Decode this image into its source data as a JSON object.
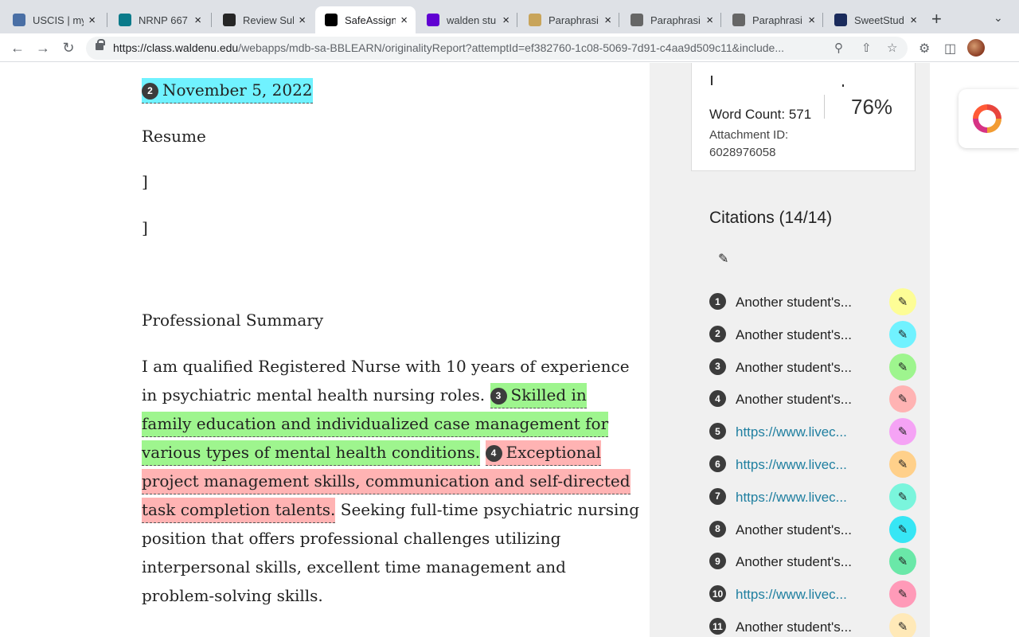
{
  "browser": {
    "tabs": [
      {
        "title": "USCIS | my",
        "favicon": "uscis-seal-icon",
        "color": "#4a6fa5"
      },
      {
        "title": "NRNP 667",
        "favicon": "wordpress-icon",
        "color": "#0a7a8a"
      },
      {
        "title": "Review Sub",
        "favicon": "blackboard-icon",
        "color": "#262626"
      },
      {
        "title": "SafeAssign",
        "favicon": "blackboard-icon",
        "color": "#000000",
        "active": true
      },
      {
        "title": "walden stu",
        "favicon": "yahoo-icon",
        "color": "#6001d2"
      },
      {
        "title": "Paraphrasi",
        "favicon": "quillbot-icon",
        "color": "#c8a45a"
      },
      {
        "title": "Paraphrasi",
        "favicon": "paraphrase-pen-icon",
        "color": "#666666"
      },
      {
        "title": "Paraphrasi",
        "favicon": "paraphrase-pen-icon",
        "color": "#666666"
      },
      {
        "title": "SweetStud",
        "favicon": "sweetstudy-icon",
        "color": "#1a2b5c"
      }
    ],
    "url": {
      "host": "https://class.waldenu.edu",
      "path": "/webapps/mdb-sa-BBLEARN/originalityReport?attemptId=ef382760-1c08-5069-7d91-c4aa9d509c11&include..."
    }
  },
  "document": {
    "date": "November 5, 2022",
    "date_citation": "2",
    "heading_resume": "Resume",
    "bracket1": "]",
    "bracket2": "]",
    "heading_summary": "Professional Summary",
    "lines": {
      "l1": "I am qualified Registered Nurse with 10 years of experience",
      "l2a": "in psychiatric mental health nursing roles.",
      "l2b_num": "3",
      "l2b": "Skilled in",
      "l3": "family education and individualized case management for",
      "l4a": "various types of mental health conditions.",
      "l4b_num": "4",
      "l4b": "Exceptional",
      "l5": "project management skills, communication and self-directed",
      "l6a": "task completion talents.",
      "l6b": " Seeking full-time psychiatric nursing",
      "l7": "position that offers professional challenges utilizing",
      "l8": "interpersonal skills, excellent time management and",
      "l9": "problem-solving skills."
    }
  },
  "report": {
    "word_count": "Word Count: 571",
    "match_percent": "76%",
    "attachment_label": "Attachment ID:",
    "attachment_id": "6028976058",
    "citations_title": "Citations (14/14)",
    "citations": [
      {
        "n": "1",
        "label": "Another student's...",
        "link": false,
        "color": "#fdfd96"
      },
      {
        "n": "2",
        "label": "Another student's...",
        "link": false,
        "color": "#70f2ff"
      },
      {
        "n": "3",
        "label": "Another student's...",
        "link": false,
        "color": "#9ef58e"
      },
      {
        "n": "4",
        "label": "Another student's...",
        "link": false,
        "color": "#ffb3b3"
      },
      {
        "n": "5",
        "label": "https://www.livec...",
        "link": true,
        "color": "#f5a3f5"
      },
      {
        "n": "6",
        "label": "https://www.livec...",
        "link": true,
        "color": "#ffd08a"
      },
      {
        "n": "7",
        "label": "https://www.livec...",
        "link": true,
        "color": "#7af5dc"
      },
      {
        "n": "8",
        "label": "Another student's...",
        "link": false,
        "color": "#37e6f5"
      },
      {
        "n": "9",
        "label": "Another student's...",
        "link": false,
        "color": "#6ae8a8"
      },
      {
        "n": "10",
        "label": "https://www.livec...",
        "link": true,
        "color": "#ff9ab8"
      },
      {
        "n": "11",
        "label": "Another student's...",
        "link": false,
        "color": "#ffe9b8"
      }
    ]
  },
  "colors": {
    "highlight_cyan": "#70f2ff",
    "highlight_green": "#9ef58e",
    "highlight_red": "#ffb3b3",
    "link": "#1f7fa0"
  }
}
